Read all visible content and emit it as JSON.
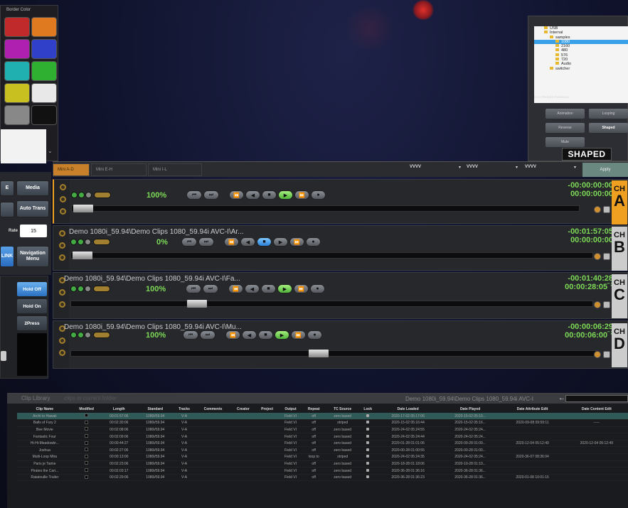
{
  "border_panel": {
    "title": "Border Color",
    "swatches": [
      "#c02a2a",
      "#e07a20",
      "#b020b0",
      "#3040c8",
      "#20b0b0",
      "#30b030",
      "#c8c020",
      "#e8e8e8",
      "#888888",
      "#111111"
    ]
  },
  "left_buttons": {
    "e": "E",
    "media": "Media",
    "blank": "",
    "auto_trans": "Auto Trans",
    "rate_label": "Rate",
    "rate_value": "15",
    "link": "LINK",
    "navigation_menu": "Navigation Menu"
  },
  "hold": {
    "off": "Hold Off",
    "on": "Hold On",
    "press2": "2Press"
  },
  "browser": {
    "tree": [
      {
        "label": "USB",
        "indent": 0
      },
      {
        "label": "Internal",
        "indent": 0
      },
      {
        "label": "samples",
        "indent": 1
      },
      {
        "label": "1080",
        "indent": 2,
        "selected": true
      },
      {
        "label": "2160",
        "indent": 2
      },
      {
        "label": "480",
        "indent": 2
      },
      {
        "label": "576",
        "indent": 2
      },
      {
        "label": "720",
        "indent": 2
      },
      {
        "label": "Audio",
        "indent": 2
      },
      {
        "label": "switcher",
        "indent": 1
      }
    ],
    "database_title": "Icon Details Database",
    "buttons": [
      "Animation",
      "Looping",
      "Reverse",
      "Shaped",
      "Mute"
    ],
    "shaped": "SHAPED"
  },
  "tabs": [
    "Mini A-D",
    "Mini E-H",
    "Mini I-L"
  ],
  "selects": [
    "VVVV",
    "VVVV",
    "VVVV"
  ],
  "apply": "Apply",
  "channels": [
    {
      "letter": "A",
      "path": "",
      "pct": "100%",
      "tc1": "-00:00:00:00",
      "tc2": "00:00:00:00",
      "tc2s": "",
      "progress": 0.0,
      "active": true,
      "state": "play"
    },
    {
      "letter": "B",
      "path": "Demo 1080i_59.94\\Demo Clips 1080_59.94i AVC-I\\Ar...",
      "pct": "0%",
      "tc1": "-00:01:57:05",
      "tc2": "00:00:00:00",
      "tc2s": "",
      "progress": 0.0,
      "active": false,
      "state": "pause"
    },
    {
      "letter": "C",
      "path": "Demo 1080i_59.94\\Demo Clips 1080_59.94i AVC-I\\Fa...",
      "pct": "100%",
      "tc1": "-00:01:40:28",
      "tc2": "00:00:28:05",
      "tc2s": "″ 2",
      "progress": 0.22,
      "active": false,
      "state": "play"
    },
    {
      "letter": "D",
      "path": "Demo 1080i_59.94\\Demo Clips 1080_59.94i AVC-I\\Mu...",
      "pct": "100%",
      "tc1": "-00:00:06:29",
      "tc2": "00:00:06:00",
      "tc2s": "″ 2",
      "progress": 0.45,
      "active": false,
      "state": "play"
    }
  ],
  "ch_label": "CH",
  "library": {
    "title": "Clip Library",
    "subtitle": "clips in current folder",
    "folder_path": "Demo 1080i_59.94\\Demo Clips 1080_59.94i AVC-I",
    "columns": [
      "Clip Name",
      "Modified",
      "Length",
      "Standard",
      "Tracks",
      "Comments",
      "Creator",
      "Project",
      "Output",
      "Repeat",
      "TC Source",
      "Lock",
      "Date Loaded",
      "Date Played",
      "Date Attribute Edit",
      "Date Content Edit"
    ],
    "rows": [
      [
        "Archi to Hawaii",
        "",
        "00:01:57:06",
        "1080i/59.94",
        "V-A",
        "",
        "",
        "",
        "Field VI",
        "off",
        "zero based",
        "",
        "2020-17-02 05:17:06",
        "2020-15-02 05:10...",
        "",
        ""
      ],
      [
        "Balls of Fury 2",
        "",
        "00:02:30:06",
        "1080i/59.94",
        "V-A",
        "",
        "",
        "",
        "Field VI",
        "off",
        "striped",
        "",
        "2020-15-02 05:16:44",
        "2020-15-02 05:16...",
        "2020-09-08 09:59:11",
        "-----"
      ],
      [
        "Bee Movie",
        "",
        "00:02:08:06",
        "1080i/59.94",
        "V-A",
        "",
        "",
        "",
        "Field VI",
        "off",
        "zero based",
        "",
        "2020-24-02 05:24:55",
        "2020-24-02 05:24...",
        "",
        ""
      ],
      [
        "Fantastic Four",
        "",
        "00:02:09:06",
        "1080i/59.94",
        "V-A",
        "",
        "",
        "",
        "Field VI",
        "off",
        "zero based",
        "",
        "2020-24-02 05:24:44",
        "2020-24-02 05:24...",
        "",
        ""
      ],
      [
        "Hi-Hi-Meadowbr...",
        "",
        "00:00:44:27",
        "1080i/59.94",
        "V-A",
        "",
        "",
        "",
        "Field VI",
        "off",
        "zero based",
        "",
        "2020-01-28 01:01:06",
        "2020-09-28 01:09...",
        "2020-12-04 05:12:49",
        "2020-12-04 05:12:49"
      ],
      [
        "Joshua",
        "",
        "00:02:27:06",
        "1080i/59.94",
        "V-A",
        "",
        "",
        "",
        "Field VI",
        "off",
        "zero based",
        "",
        "2020-00-28 01:00:55",
        "2020-00-28 01:00...",
        "",
        ""
      ],
      [
        "Multi-Loop Mira",
        "",
        "00:00:13:00",
        "1080i/59.94",
        "V-A",
        "",
        "",
        "",
        "Field VI",
        "loop to",
        "striped",
        "",
        "2020-24-02 05:24:35",
        "2020-24-02 05:24...",
        "2020-36-07 08:36:04",
        ""
      ],
      [
        "Paris je Taime",
        "",
        "00:02:23:06",
        "1080i/59.94",
        "V-A",
        "",
        "",
        "",
        "Field VI",
        "off",
        "zero based",
        "",
        "2020-18-28 01:18:06",
        "2020-10-28 01:10...",
        "",
        ""
      ],
      [
        "Pirates the Cari...",
        "",
        "00:02:03:17",
        "1080i/59.94",
        "V-A",
        "",
        "",
        "",
        "Field VI",
        "off",
        "zero based",
        "",
        "2020-36-28 01:36:16",
        "2020-36-28 01:36...",
        "",
        ""
      ],
      [
        "Ratatouille Trailer",
        "",
        "00:02:29:06",
        "1080i/59.94",
        "V-A",
        "",
        "",
        "",
        "Field VI",
        "off",
        "zero based",
        "",
        "2020-36-28 01:36:23",
        "2020-36-28 01:36...",
        "2020-01-08 10:01:16",
        ""
      ]
    ]
  }
}
